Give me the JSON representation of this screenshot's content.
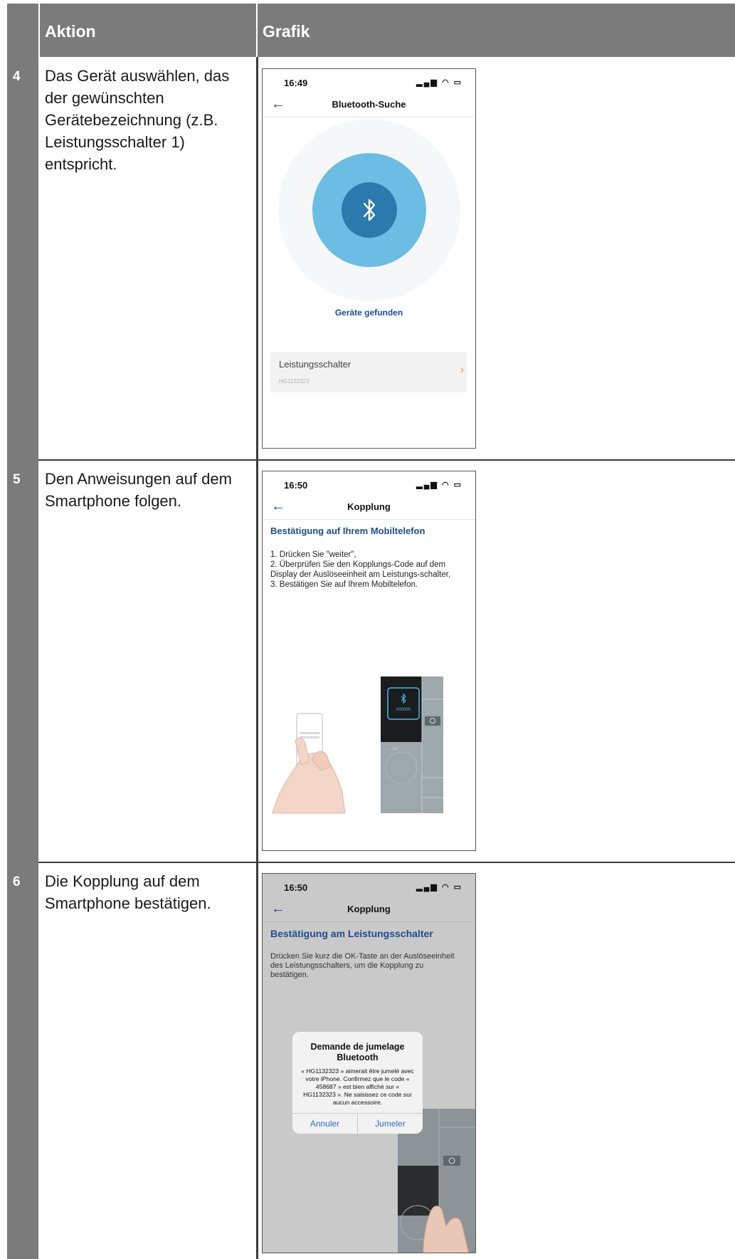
{
  "header": {
    "col_action": "Aktion",
    "col_graphic": "Grafik"
  },
  "rows": [
    {
      "num": "4",
      "action": "Das Gerät auswählen, das der gewünschten Gerätebezeichnung (z.B. Leistungsschalter 1) entspricht.",
      "phone": {
        "time": "16:49",
        "nav_title": "Bluetooth-Suche",
        "found_label": "Geräte gefunden",
        "device_name": "Leistungsschalter",
        "device_id": "HG1132323"
      }
    },
    {
      "num": "5",
      "action": "Den Anweisungen auf dem Smartphone folgen.",
      "phone": {
        "time": "16:50",
        "nav_title": "Kopplung",
        "heading": "Bestätigung auf Ihrem Mobiltelefon",
        "instructions": "1. Drücken Sie \"weiter\",\n2. Überprüfen Sie den Kopplungs-Code auf dem Display der Auslöseeinheit am Leistungs-schalter,\n3. Bestätigen Sie auf Ihrem Mobiltelefon.",
        "device_code": "000000"
      }
    },
    {
      "num": "6",
      "action": "Die Kopplung auf dem Smartphone bestätigen.",
      "phone": {
        "time": "16:50",
        "nav_title": "Kopplung",
        "heading": "Bestätigung am Leistungsschalter",
        "instructions": "Drücken Sie kurz die OK-Taste an der Auslöseeinheit des Leistungsschalters, um die Kopplung zu bestätigen.",
        "dialog_title": "Demande de jumelage Bluetooth",
        "dialog_body": "« HG1132323 » aimerait être jumelé avec votre iPhone. Confirmez que le code « 458687 » est bien affiché sur « HG1132323 ». Ne saisissez ce code sur aucun accessoire.",
        "cancel_label": "Annuler",
        "pair_label": "Jumeler"
      }
    }
  ],
  "colors": {
    "header_gray": "#7b7b7b",
    "app_blue": "#1b4d8c",
    "bt_light": "#6bbde3",
    "bt_dark": "#2a7aae",
    "ios_blue": "#2b72c9"
  }
}
